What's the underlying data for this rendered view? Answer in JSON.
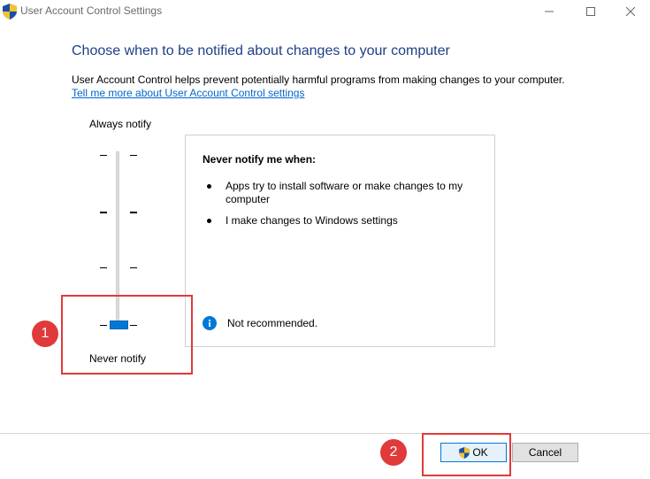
{
  "window": {
    "title": "User Account Control Settings"
  },
  "main": {
    "heading": "Choose when to be notified about changes to your computer",
    "description": "User Account Control helps prevent potentially harmful programs from making changes to your computer.",
    "link": "Tell me more about User Account Control settings"
  },
  "slider": {
    "top_label": "Always notify",
    "bottom_label": "Never notify",
    "levels": 4,
    "selected_level": 1
  },
  "panel": {
    "title": "Never notify me when:",
    "bullets": [
      "Apps try to install software or make changes to my computer",
      "I make changes to Windows settings"
    ],
    "status": "Not recommended."
  },
  "annotations": {
    "badge1": "1",
    "badge2": "2"
  },
  "buttons": {
    "ok": "OK",
    "cancel": "Cancel"
  },
  "colors": {
    "heading": "#1e3f87",
    "link": "#0066cc",
    "accent": "#0078d7",
    "annotation": "#e03a3a"
  },
  "icons": {
    "title": "uac-shield-icon",
    "info": "info-icon",
    "ok": "uac-shield-icon"
  }
}
